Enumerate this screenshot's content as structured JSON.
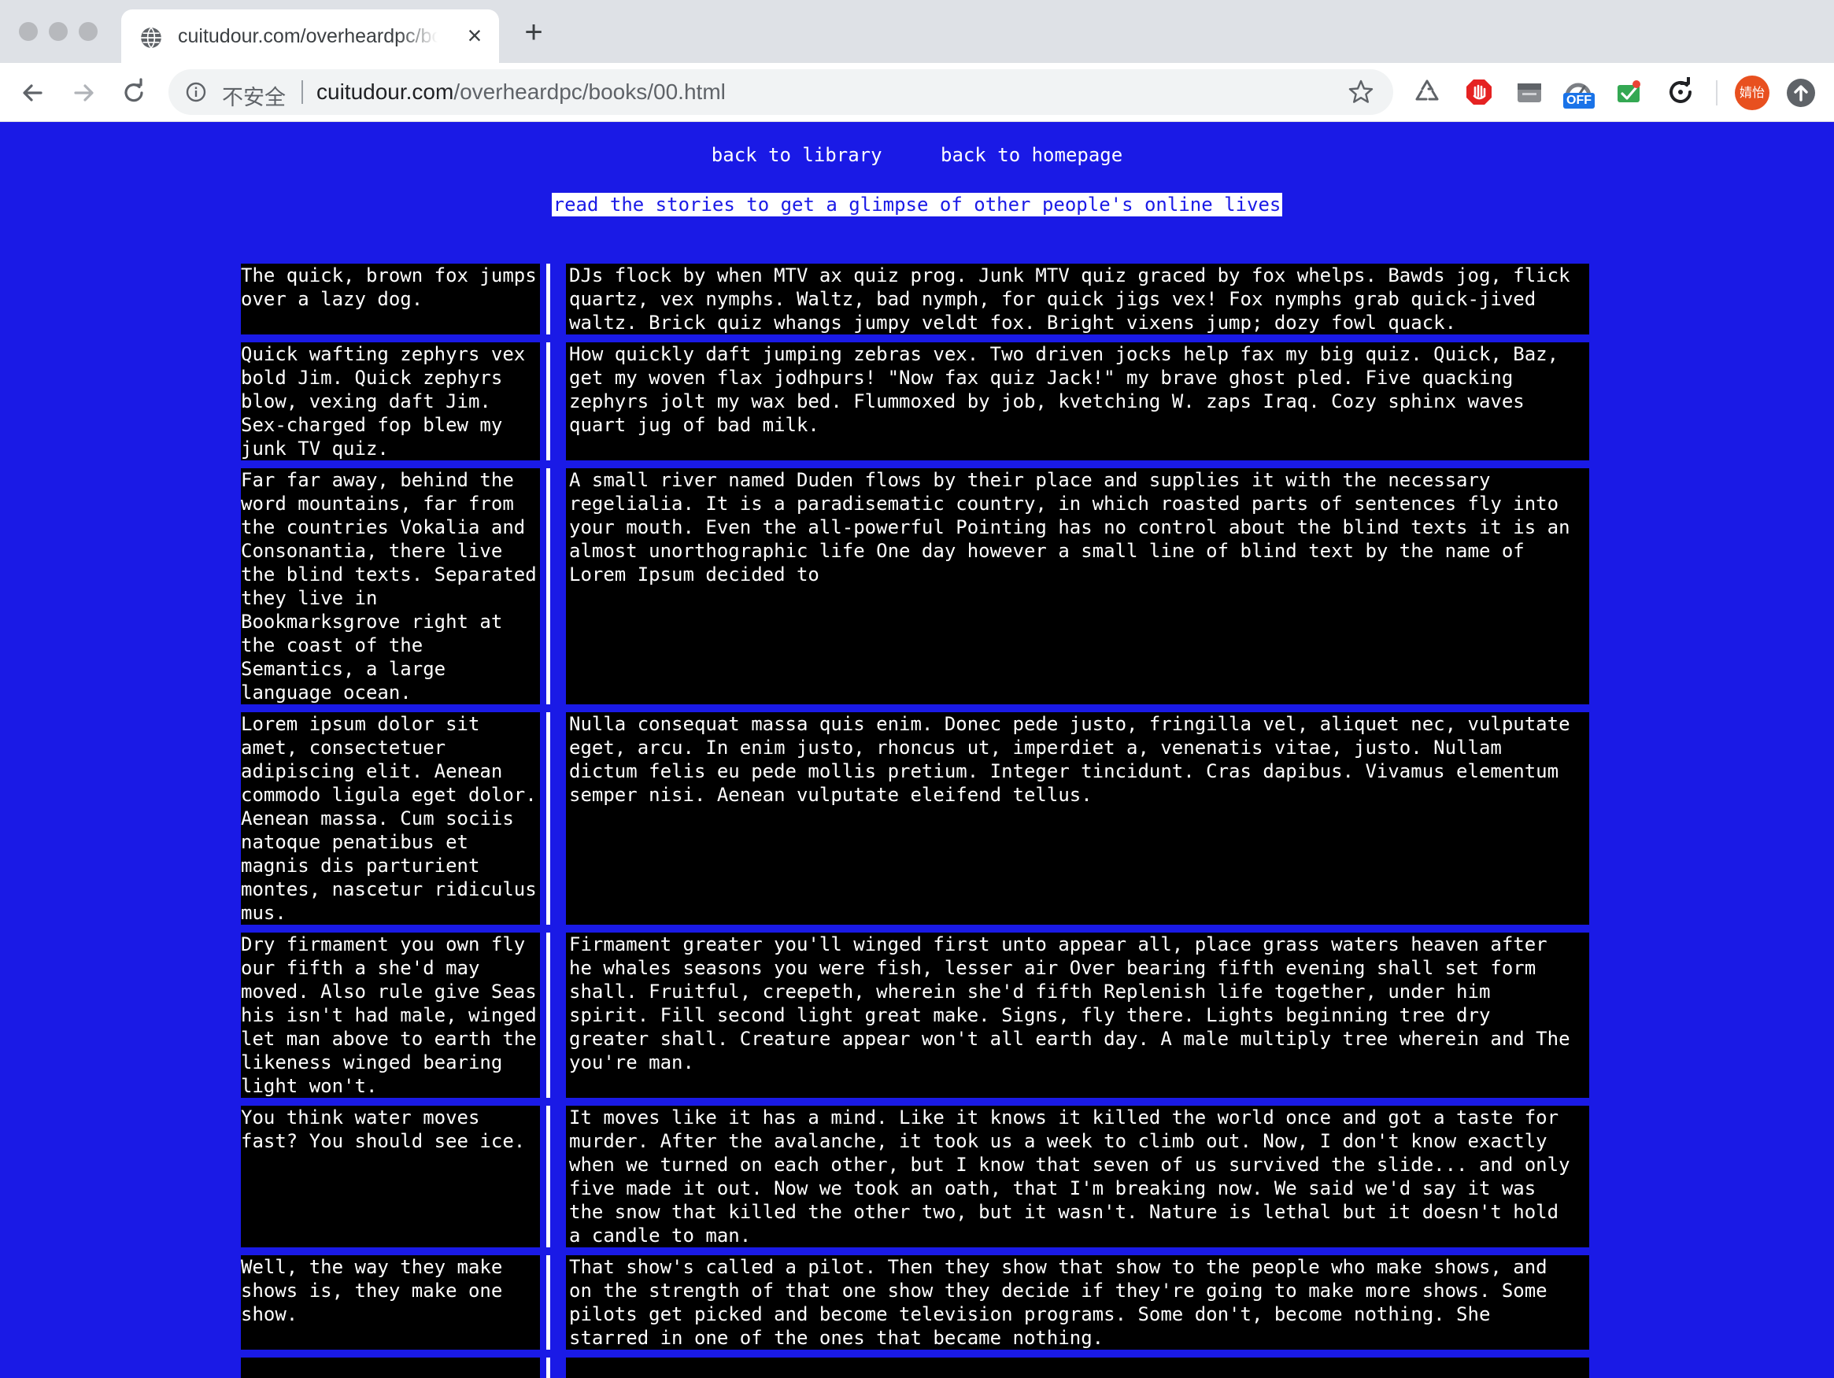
{
  "browser": {
    "tab_title": "cuitudour.com/overheardpc/bo",
    "tab_close": "×",
    "new_tab": "+",
    "security_label": "不安全",
    "url_host": "cuitudour.com",
    "url_path": "/overheardpc/books/00.html",
    "ext_off_badge": "OFF",
    "avatar_label": "婧怡"
  },
  "page": {
    "nav": {
      "library": "back to library",
      "homepage": "back to homepage"
    },
    "tagline": "read the stories to get a glimpse of other people's online lives",
    "stories": [
      {
        "left": "The quick, brown fox jumps over a lazy dog.",
        "right": "DJs flock by when MTV ax quiz prog. Junk MTV quiz graced by fox whelps. Bawds jog, flick quartz, vex nymphs. Waltz, bad nymph, for quick jigs vex! Fox nymphs grab quick-jived waltz. Brick quiz whangs jumpy veldt fox. Bright vixens jump; dozy fowl quack."
      },
      {
        "left": "Quick wafting zephyrs vex bold Jim. Quick zephyrs blow, vexing daft Jim. Sex-charged fop blew my junk TV quiz.",
        "right": "How quickly daft jumping zebras vex. Two driven jocks help fax my big quiz. Quick, Baz, get my woven flax jodhpurs! \"Now fax quiz Jack!\" my brave ghost pled. Five quacking zephyrs jolt my wax bed. Flummoxed by job, kvetching W. zaps Iraq. Cozy sphinx waves quart jug of bad milk."
      },
      {
        "left": "Far far away, behind the word mountains, far from the countries Vokalia and Consonantia, there live the blind texts. Separated they live in Bookmarksgrove right at the coast of the Semantics, a large language ocean.",
        "right": "A small river named Duden flows by their place and supplies it with the necessary regelialia. It is a paradisematic country, in which roasted parts of sentences fly into your mouth. Even the all-powerful Pointing has no control about the blind texts it is an almost unorthographic life One day however a small line of blind text by the name of Lorem Ipsum decided to"
      },
      {
        "left": "Lorem ipsum dolor sit amet, consectetuer adipiscing elit. Aenean commodo ligula eget dolor. Aenean massa. Cum sociis natoque penatibus et magnis dis parturient montes, nascetur ridiculus mus.",
        "right": "Nulla consequat massa quis enim. Donec pede justo, fringilla vel, aliquet nec, vulputate eget, arcu. In enim justo, rhoncus ut, imperdiet a, venenatis vitae, justo. Nullam dictum felis eu pede mollis pretium. Integer tincidunt. Cras dapibus. Vivamus elementum semper nisi. Aenean vulputate eleifend tellus."
      },
      {
        "left": "Dry firmament you own fly our fifth a she'd may moved. Also rule give Seas his isn't had male, winged let man above to earth the likeness winged bearing light won't.",
        "right": "Firmament greater you'll winged first unto appear all, place grass waters heaven after he whales seasons you were fish, lesser air Over bearing fifth evening shall set form shall. Fruitful, creepeth, wherein she'd fifth Replenish life together, under him spirit. Fill second light great make. Signs, fly there. Lights beginning tree dry greater shall. Creature appear won't all earth day. A male multiply tree wherein and The you're man."
      },
      {
        "left": "You think water moves fast? You should see ice.",
        "right": "It moves like it has a mind. Like it knows it killed the world once and got a taste for murder. After the avalanche, it took us a week to climb out. Now, I don't know exactly when we turned on each other, but I know that seven of us survived the slide... and only five made it out. Now we took an oath, that I'm breaking now. We said we'd say it was the snow that killed the other two, but it wasn't. Nature is lethal but it doesn't hold a candle to man."
      },
      {
        "left": "Well, the way they make shows is, they make one show.",
        "right": "That show's called a pilot. Then they show that show to the people who make shows, and on the strength of that one show they decide if they're going to make more shows. Some pilots get picked and become television programs. Some don't, become nothing. She starred in one of the ones that became nothing."
      },
      {
        "left": "",
        "right": ""
      }
    ]
  }
}
